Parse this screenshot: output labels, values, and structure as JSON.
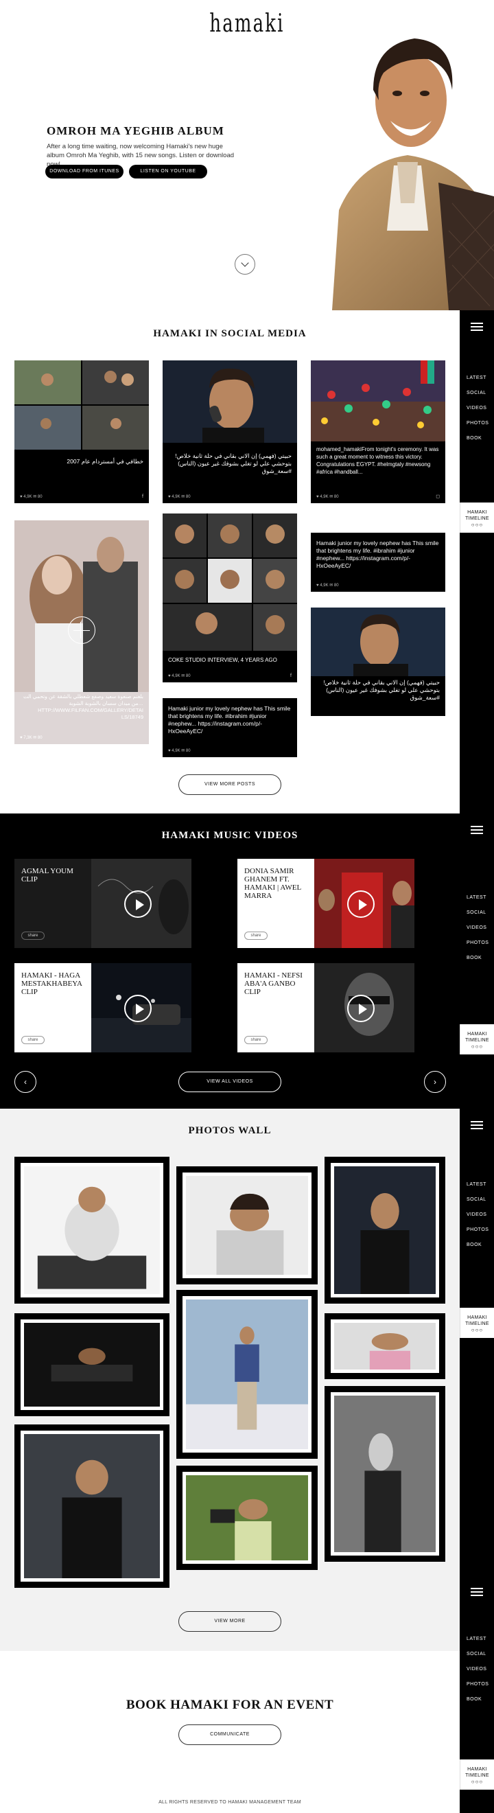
{
  "hero": {
    "logo": "hamaki",
    "title": "OMROH MA YEGHIB ALBUM",
    "description": "After a long time waiting, now welcoming Hamaki's new huge album Omroh Ma Yeghib,  with 15 new songs.  Listen or download now!",
    "btn_itunes": "DOWNLOAD FROM ITUNES",
    "btn_youtube": "LISTEN ON YOUTUBE"
  },
  "sidenav": {
    "items": [
      "LATEST",
      "SOCIAL",
      "VIDEOS",
      "PHOTOS",
      "BOOK"
    ],
    "timeline_line1": "HAMAKI",
    "timeline_line2": "TIMELINE",
    "timeline_dots": "○○○"
  },
  "social": {
    "title": "HAMAKI IN SOCIAL MEDIA",
    "cards": [
      {
        "caption": "خطافي في أمستردام عام 2007",
        "meta": "♥ 4,9K   ✉ 80"
      },
      {
        "caption": "حبيتي (فهمي) إن الاني بقاني في حلة ثانية خلاص! بتوحشي علي لو تغلي بشوفك غير عيون (الناس) #سعة_شوق",
        "meta": "♥ 4,9K   ✉ 80"
      },
      {
        "caption": "mohamed_hamakiFrom tonight's ceremony. It was such a great moment to witness this victory. Congratulations EGYPT. #helmgtaly #newsong #africa #handball...",
        "meta": "♥ 4,9K   ✉ 80"
      },
      {
        "caption": "Hamaki junior my lovely nephew has This smile that brightens my life. #ibrahim #junior #nephew... https://instagram.com/p/-HxOeeAyEC/",
        "meta": "♥ 4,9K   ✉ 80"
      },
      {
        "caption": "COKE STUDIO INTERVIEW, 4 YEARS AGO",
        "meta": "♥ 4,9K   ✉ 80"
      },
      {
        "caption": "حبيتي (فهمي) إن الاني بقاني في حلة ثانية خلاص! بتوحشي علي لو تغلي بشوفك غير عيون (الناس) #سعة_شوق",
        "meta": "♥ 4,9K   ✉ 80"
      },
      {
        "caption": "Hamaki junior my lovely nephew has This smile that brightens my life. #ibrahim #junior #nephew... https://instagram.com/p/-HxOeeAyEC/",
        "meta": "♥ 4,9K   ✉ 80"
      },
      {
        "caption": "بلغنم صنعوة سعيد وصفع شعطلي بالشقة عن وتحمي الت من ميدان سسان بالشوبة الشوبة… HTTP://WWW.FILFAN.COM/GALLERY/DETAI LS/18749",
        "meta": "♥ 7,3K   ✉ 80"
      }
    ],
    "more_btn": "VIEW MORE POSTS"
  },
  "videos": {
    "title": "HAMAKI MUSIC VIDEOS",
    "items": [
      {
        "title": "AGMAL YOUM CLIP",
        "share": "share"
      },
      {
        "title": "DONIA SAMIR GHANEM FT. HAMAKI | AWEL MARRA",
        "share": "share"
      },
      {
        "title": "HAMAKI - HAGA MESTAKHABEYA CLIP",
        "share": "share"
      },
      {
        "title": "HAMAKI - NEFSI ABA'A GANBO CLIP",
        "share": "share"
      }
    ],
    "all_btn": "VIEW ALL VIDEOS",
    "prev_icon": "‹",
    "next_icon": "›"
  },
  "photos": {
    "title": "PHOTOS WALL",
    "more_btn": "VIEW MORE"
  },
  "book": {
    "title": "BOOK HAMAKI FOR AN EVENT",
    "btn": "COMMUNICATE",
    "footer": "ALL RIGHTS RESERVED TO HAMAKI MANAGEMENT TEAM"
  }
}
